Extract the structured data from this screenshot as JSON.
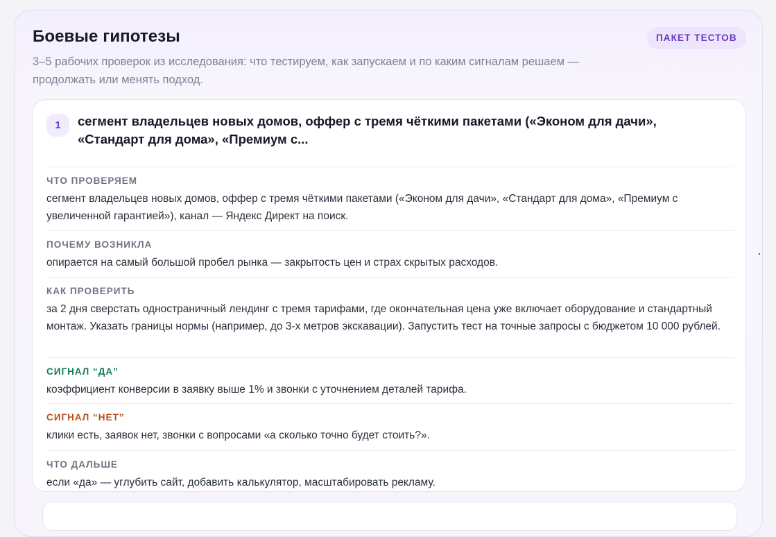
{
  "panel": {
    "title": "Боевые гипотезы",
    "badge": "ПАКЕТ ТЕСТОВ",
    "subtitle": "3–5 рабочих проверок из исследования: что тестируем, как запускаем и по каким сигналам решаем — продолжать или менять подход."
  },
  "hypothesis": {
    "number": "1",
    "title": "сегмент владельцев новых домов, оффер с тремя чёткими пакетами («Эконом для дачи», «Стандарт для дома», «Премиум с...",
    "sections": [
      {
        "label": "ЧТО ПРОВЕРЯЕМ",
        "text": "сегмент владельцев новых домов, оффер с тремя чёткими пакетами («Эконом для дачи», «Стандарт для дома», «Премиум с увеличенной гарантией»), канал — Яндекс Директ на поиск."
      },
      {
        "label": "ПОЧЕМУ ВОЗНИКЛА",
        "text": "опирается на самый большой пробел рынка — закрытость цен и страх скрытых расходов."
      },
      {
        "label": "КАК ПРОВЕРИТЬ",
        "text": "за 2 дня сверстать одностраничный лендинг с тремя тарифами, где окончательная цена уже включает оборудование и стандартный монтаж. Указать границы нормы (например, до 3-х метров экскавации). Запустить тест на точные запросы с бюджетом 10 000 рублей."
      },
      {
        "label": "СИГНАЛ “ДА”",
        "text": "коэффициент конверсии в заявку выше 1% и звонки с уточнением деталей тарифа."
      },
      {
        "label": "СИГНАЛ “НЕТ”",
        "text": "клики есть, заявок нет, звонки с вопросами «а сколько точно будет стоить?»."
      },
      {
        "label": "ЧТО ДАЛЬШЕ",
        "text": "если «да» — углубить сайт, добавить калькулятор, масштабировать рекламу."
      }
    ]
  },
  "colors": {
    "accent": "#6b37c6",
    "signal_yes": "#137a52",
    "signal_no": "#b64f1f"
  }
}
